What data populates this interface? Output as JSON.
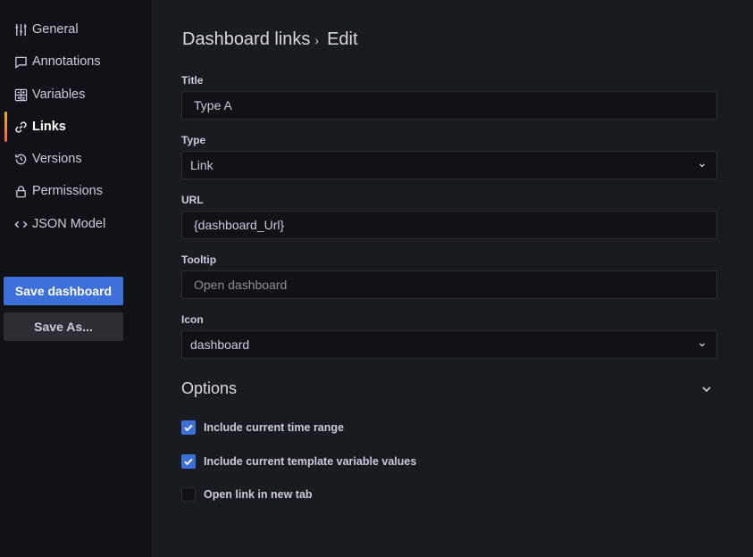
{
  "sidebar": {
    "items": [
      {
        "label": "General",
        "icon": "sliders-icon"
      },
      {
        "label": "Annotations",
        "icon": "comment-icon"
      },
      {
        "label": "Variables",
        "icon": "calculator-icon"
      },
      {
        "label": "Links",
        "icon": "link-icon",
        "active": true
      },
      {
        "label": "Versions",
        "icon": "history-icon"
      },
      {
        "label": "Permissions",
        "icon": "lock-icon"
      },
      {
        "label": "JSON Model",
        "icon": "code-icon"
      }
    ],
    "save_label": "Save dashboard",
    "save_as_label": "Save As..."
  },
  "breadcrumb": {
    "parent": "Dashboard links",
    "separator": "›",
    "current": "Edit"
  },
  "form": {
    "title": {
      "label": "Title",
      "value": "Type A"
    },
    "type": {
      "label": "Type",
      "value": "Link"
    },
    "url": {
      "label": "URL",
      "value": "{dashboard_Url}"
    },
    "tooltip": {
      "label": "Tooltip",
      "placeholder": "Open dashboard"
    },
    "icon": {
      "label": "Icon",
      "value": "dashboard"
    }
  },
  "options": {
    "title": "Options",
    "checkboxes": [
      {
        "label": "Include current time range",
        "checked": true
      },
      {
        "label": "Include current template variable values",
        "checked": true
      },
      {
        "label": "Open link in new tab",
        "checked": false
      }
    ]
  },
  "colors": {
    "accent": "#3d71d9",
    "active_bar": "#f55f3e"
  }
}
